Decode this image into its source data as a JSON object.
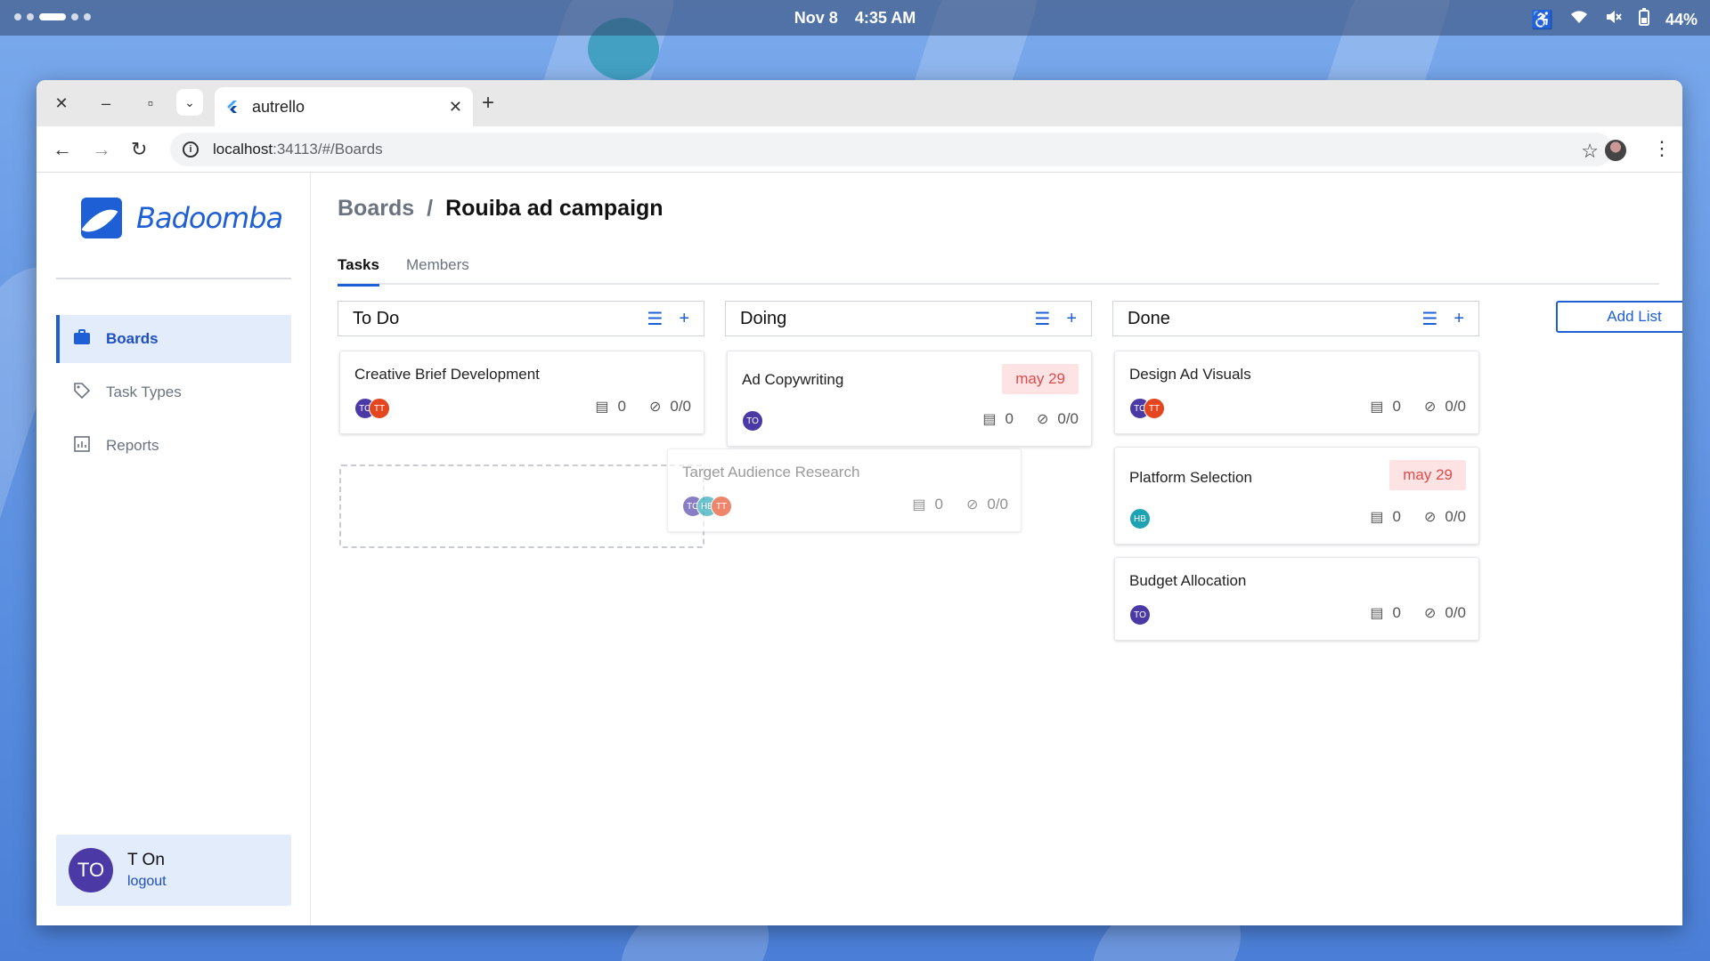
{
  "system": {
    "date": "Nov 8",
    "time": "4:35 AM",
    "battery": "44%"
  },
  "browser": {
    "tab_title": "autrello",
    "url_host": "localhost",
    "url_path": ":34113/#/Boards"
  },
  "app": {
    "brand": "Badoomba",
    "nav": [
      {
        "label": "Boards",
        "icon": "briefcase-icon",
        "active": true
      },
      {
        "label": "Task Types",
        "icon": "tag-icon",
        "active": false
      },
      {
        "label": "Reports",
        "icon": "chart-icon",
        "active": false
      }
    ],
    "user": {
      "initials": "TO",
      "name": "T On",
      "logout": "logout"
    }
  },
  "board": {
    "breadcrumb_root": "Boards",
    "breadcrumb_sep": "/",
    "title": "Rouiba ad campaign",
    "tabs": [
      "Tasks",
      "Members"
    ],
    "add_list": "Add List",
    "lists": [
      {
        "name": "To Do",
        "cards": [
          {
            "title": "Creative Brief Development",
            "due": "",
            "avatars": [
              "TO",
              "TT"
            ],
            "comments": "0",
            "checks": "0/0"
          }
        ],
        "dragging": {
          "title": "Target Audience Research",
          "avatars": [
            "TO",
            "HB",
            "TT"
          ],
          "comments": "0",
          "checks": "0/0"
        }
      },
      {
        "name": "Doing",
        "cards": [
          {
            "title": "Ad Copywriting",
            "due": "may 29",
            "avatars": [
              "TO"
            ],
            "comments": "0",
            "checks": "0/0"
          }
        ]
      },
      {
        "name": "Done",
        "cards": [
          {
            "title": "Design Ad Visuals",
            "due": "",
            "avatars": [
              "TO",
              "TT"
            ],
            "comments": "0",
            "checks": "0/0"
          },
          {
            "title": "Platform Selection",
            "due": "may 29",
            "avatars": [
              "HB"
            ],
            "comments": "0",
            "checks": "0/0"
          },
          {
            "title": "Budget Allocation",
            "due": "",
            "avatars": [
              "TO"
            ],
            "comments": "0",
            "checks": "0/0"
          }
        ]
      }
    ]
  },
  "colors": {
    "accent": "#1e5fd6",
    "avatar_TO": "#4b3aa6",
    "avatar_TT": "#e4461f",
    "avatar_HB": "#1ea3b3",
    "due_bg": "#fde3e3",
    "due_text": "#e04b4b"
  }
}
